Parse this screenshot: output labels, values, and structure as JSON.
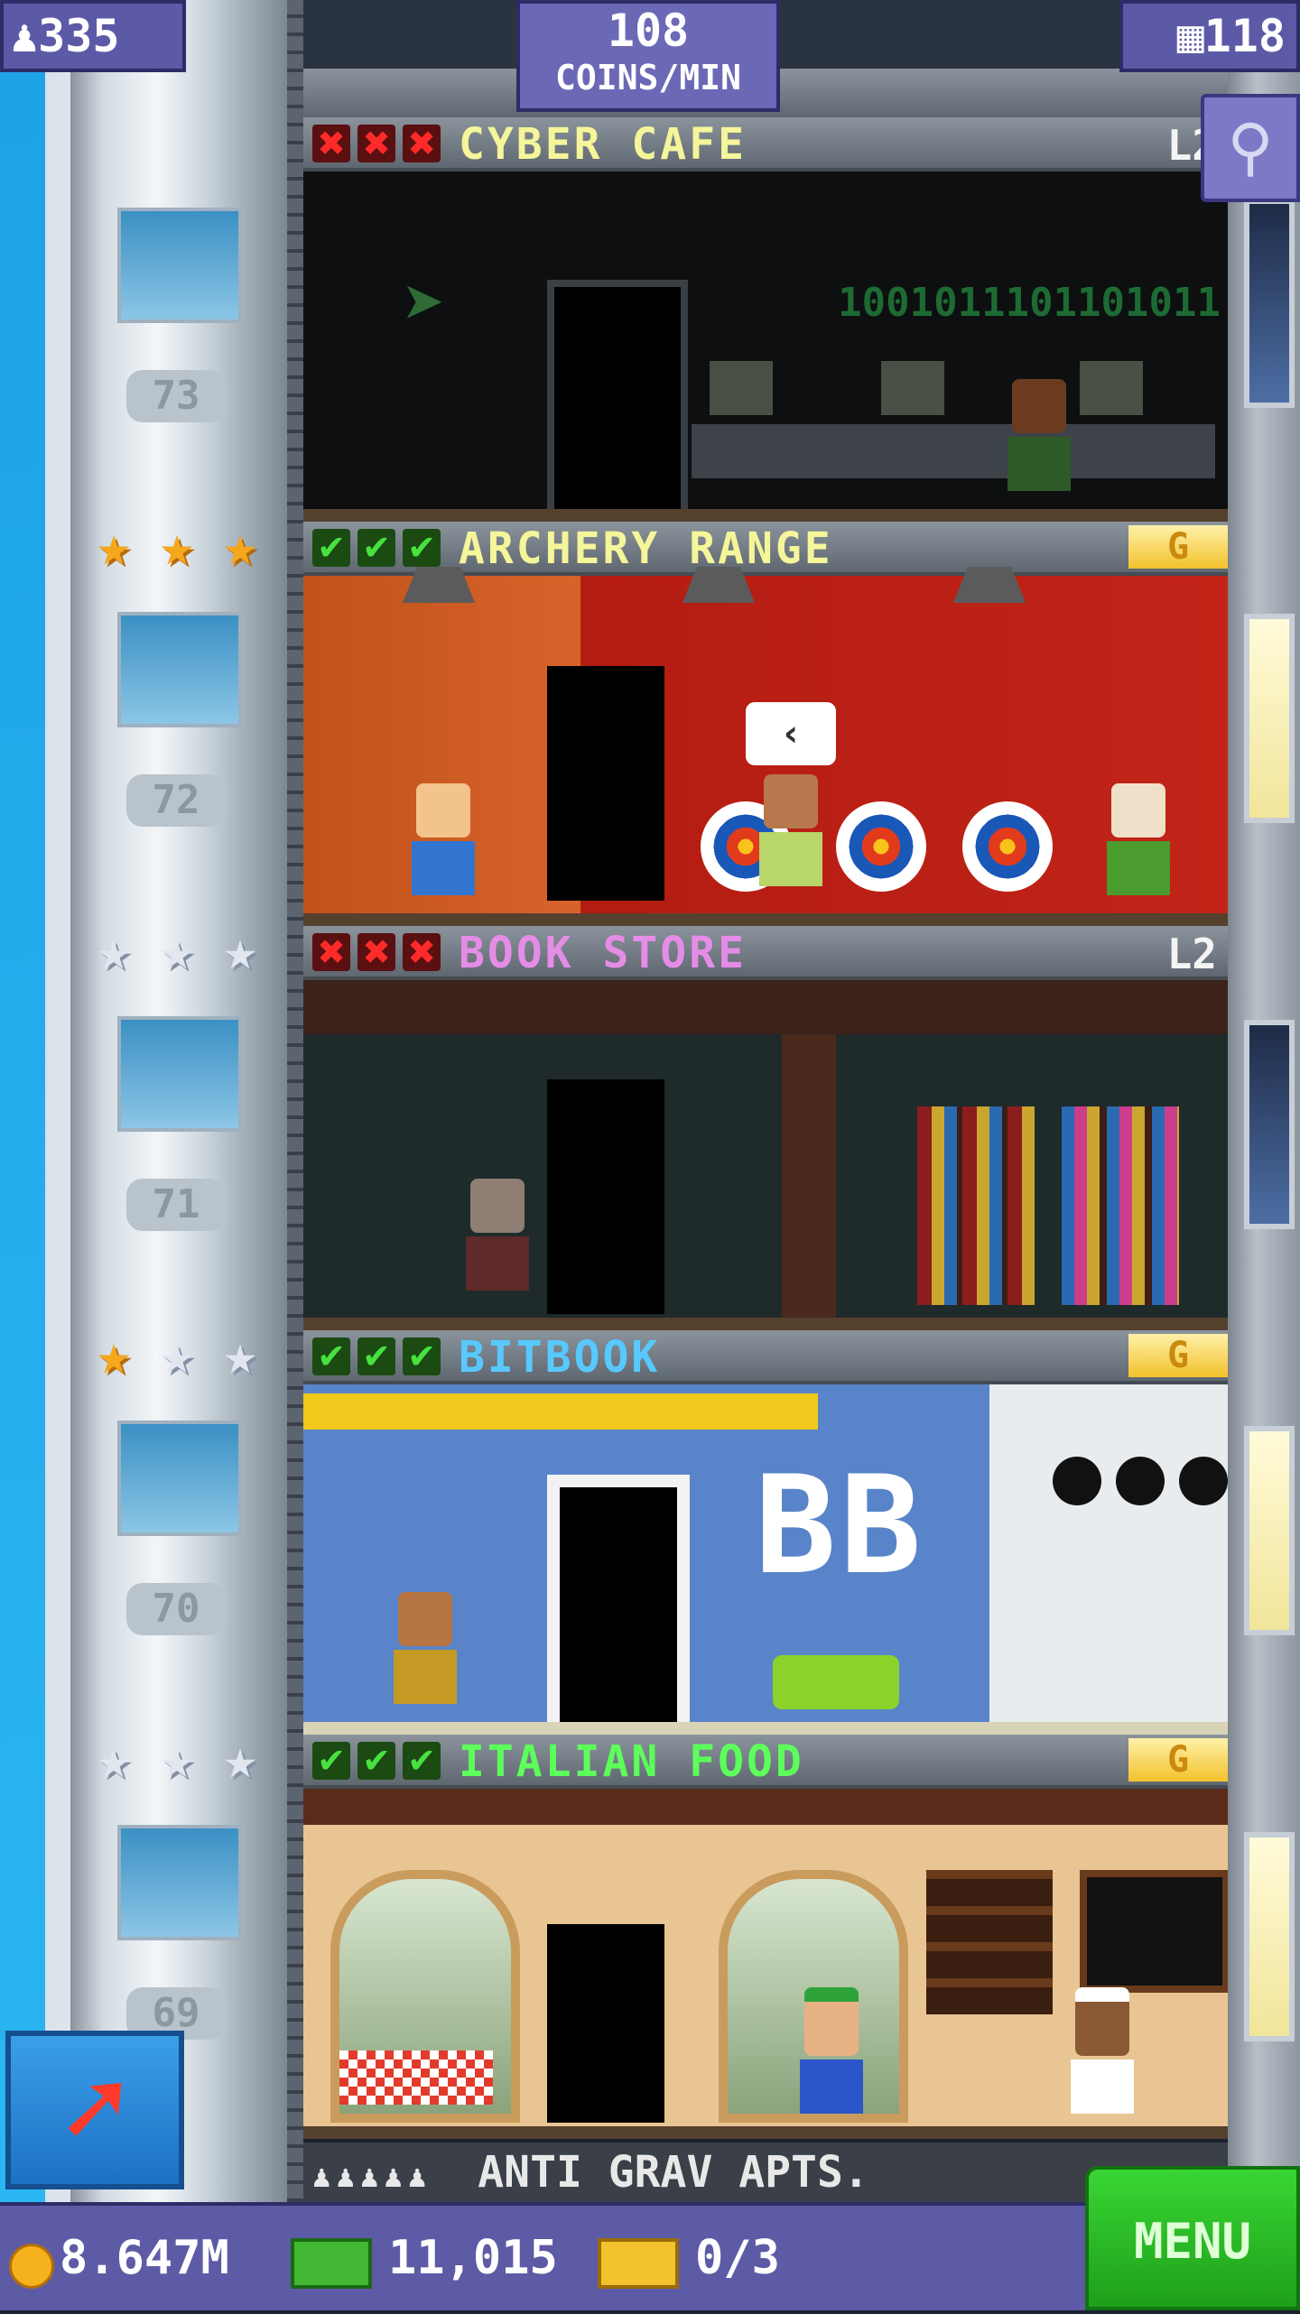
{
  "hud": {
    "population": "335",
    "coins_per_min_value": "108",
    "coins_per_min_label": "COINS/MIN",
    "floors": "118"
  },
  "floors": [
    {
      "number": "73",
      "title": "CYBER CAFE",
      "title_color": "#f5f59a",
      "checks": [
        "x",
        "x",
        "x"
      ],
      "badge": "L2",
      "stars": [],
      "binary": "1001011101101011"
    },
    {
      "number": "72",
      "title": "ARCHERY RANGE",
      "title_color": "#f5f59a",
      "checks": [
        "ok",
        "ok",
        "ok"
      ],
      "badge": "G",
      "stars": [
        "gold",
        "gold",
        "gold"
      ]
    },
    {
      "number": "71",
      "title": "BOOK STORE",
      "title_color": "#e58ce6",
      "checks": [
        "x",
        "x",
        "x"
      ],
      "badge": "L2",
      "stars": [
        "silver",
        "silver",
        "silver"
      ]
    },
    {
      "number": "70",
      "title": "BITBOOK",
      "title_color": "#57c9ff",
      "checks": [
        "ok",
        "ok",
        "ok"
      ],
      "badge": "G",
      "stars": [
        "gold",
        "silver",
        "silver"
      ],
      "logo": "BB"
    },
    {
      "number": "69",
      "title": "ITALIAN FOOD",
      "title_color": "#5dff5a",
      "checks": [
        "ok",
        "ok",
        "ok"
      ],
      "badge": "G",
      "stars": [
        "silver",
        "silver",
        "silver"
      ]
    }
  ],
  "lobby": {
    "label": "ANTI GRAV APTS."
  },
  "bottom_bar": {
    "coins": "8.647M",
    "bux": "11,015",
    "tickets": "0/3",
    "menu_label": "MENU"
  },
  "icons": {
    "population": "person-icon",
    "floors": "building-icon",
    "search": "magnifier-icon",
    "build": "up-arrow-icon"
  }
}
